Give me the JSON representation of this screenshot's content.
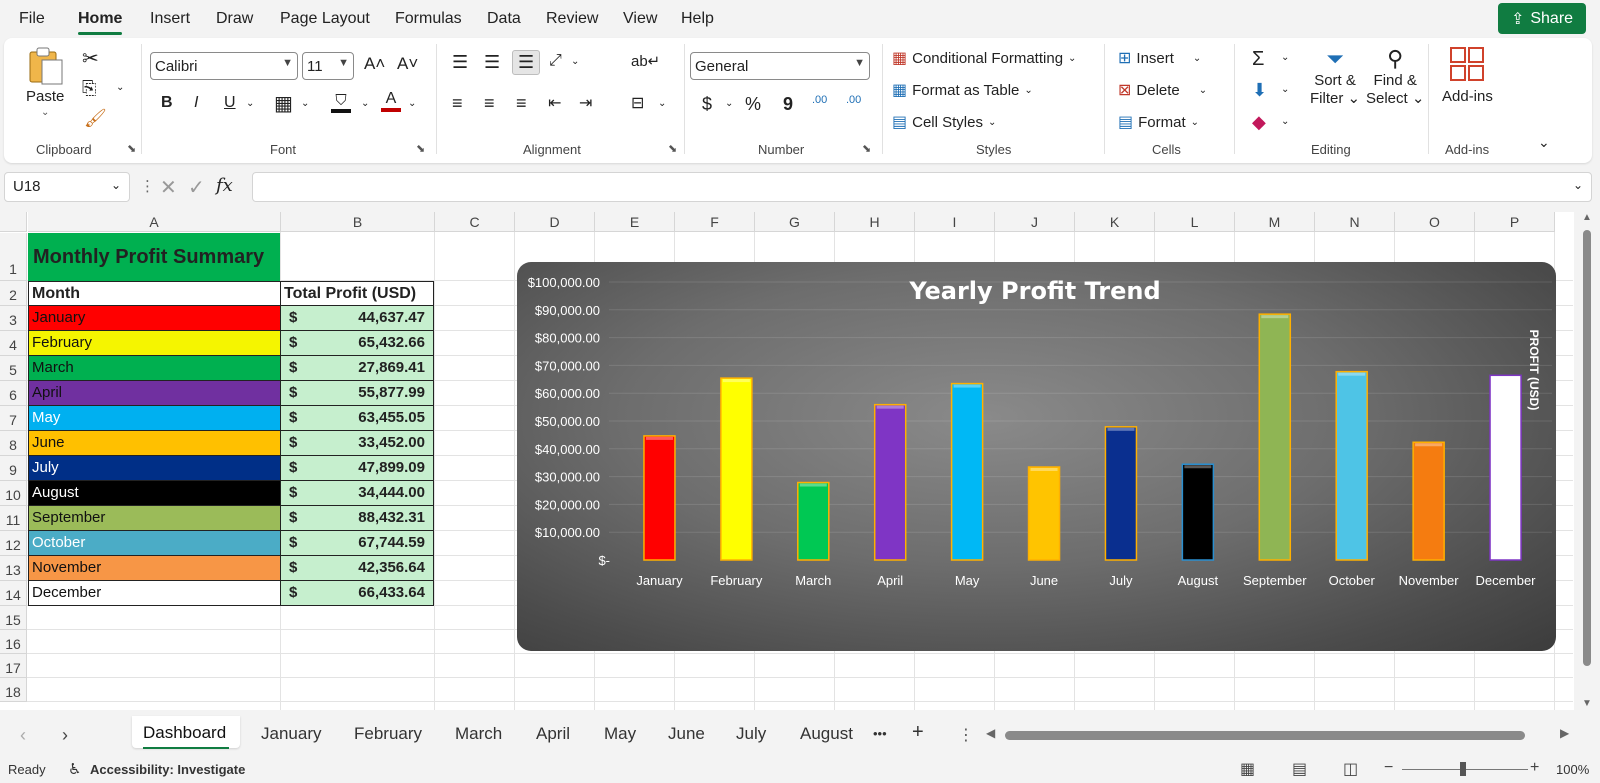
{
  "menu": {
    "tabs": [
      "File",
      "Home",
      "Insert",
      "Draw",
      "Page Layout",
      "Formulas",
      "Data",
      "Review",
      "View",
      "Help"
    ],
    "active": "Home",
    "share_label": "Share"
  },
  "ribbon": {
    "clipboard": {
      "paste": "Paste",
      "label": "Clipboard"
    },
    "font": {
      "name": "Calibri",
      "size": "11",
      "bold": "B",
      "italic": "I",
      "underline": "U",
      "label": "Font"
    },
    "alignment": {
      "label": "Alignment"
    },
    "number": {
      "format": "General",
      "currency": "$",
      "percent": "%",
      "comma": "9",
      "inc_decimal": ".00",
      "dec_decimal": ".00",
      "label": "Number"
    },
    "styles": {
      "conditional": "Conditional Formatting",
      "format_table": "Format as Table",
      "cell_styles": "Cell Styles",
      "label": "Styles"
    },
    "cells": {
      "insert": "Insert",
      "delete": "Delete",
      "format": "Format",
      "label": "Cells"
    },
    "editing": {
      "sort_filter_1": "Sort &",
      "sort_filter_2": "Filter",
      "find_select_1": "Find &",
      "find_select_2": "Select",
      "label": "Editing"
    },
    "addins": {
      "button": "Add-ins",
      "label": "Add-ins"
    }
  },
  "formula_bar": {
    "name_box": "U18",
    "fx": "fx",
    "formula": ""
  },
  "grid": {
    "columns": [
      "A",
      "B",
      "C",
      "D",
      "E",
      "F",
      "G",
      "H",
      "I",
      "J",
      "K",
      "L",
      "M",
      "N",
      "O",
      "P"
    ],
    "rows": [
      "1",
      "2",
      "3",
      "4",
      "5",
      "6",
      "7",
      "8",
      "9",
      "10",
      "11",
      "12",
      "13",
      "14",
      "15",
      "16",
      "17",
      "18"
    ],
    "title": "Monthly Profit Summary",
    "header_month": "Month",
    "header_profit": "Total Profit (USD)",
    "currency_symbol": "$",
    "months": [
      "January",
      "February",
      "March",
      "April",
      "May",
      "June",
      "July",
      "August",
      "September",
      "October",
      "November",
      "December"
    ],
    "profits": [
      "44,637.47",
      "65,432.66",
      "27,869.41",
      "55,877.99",
      "63,455.05",
      "33,452.00",
      "47,899.09",
      "34,444.00",
      "88,432.31",
      "67,744.59",
      "42,356.64",
      "66,433.64"
    ],
    "month_colors": [
      "#ff0000",
      "#f5f500",
      "#00b050",
      "#7030a0",
      "#00b0f0",
      "#ffc000",
      "#002f87",
      "#000000",
      "#9bbb59",
      "#4bacc6",
      "#f79646",
      "#ffffff"
    ],
    "title_bg": "#00b050",
    "profit_bg": "#c6efce"
  },
  "chart_data": {
    "type": "bar",
    "title": "Yearly Profit Trend",
    "ylabel": "PROFIT (USD)",
    "xlabel": "",
    "categories": [
      "January",
      "February",
      "March",
      "April",
      "May",
      "June",
      "July",
      "August",
      "September",
      "October",
      "November",
      "December"
    ],
    "values": [
      44637.47,
      65432.66,
      27869.41,
      55877.99,
      63455.05,
      33452.0,
      47899.09,
      34444.0,
      88432.31,
      67744.59,
      42356.64,
      66433.64
    ],
    "colors": [
      "#ff0000",
      "#ffff00",
      "#00c853",
      "#7f35c5",
      "#00b8f5",
      "#ffc400",
      "#0a2f8f",
      "#000000",
      "#8fb554",
      "#4ec4e6",
      "#f57c10",
      "#ffffff"
    ],
    "ylim": [
      0,
      100000
    ],
    "yticks": [
      "$-",
      "$10,000.00",
      "$20,000.00",
      "$30,000.00",
      "$40,000.00",
      "$50,000.00",
      "$60,000.00",
      "$70,000.00",
      "$80,000.00",
      "$90,000.00",
      "$100,000.00"
    ],
    "grid": true
  },
  "sheets": {
    "tabs": [
      "Dashboard",
      "January",
      "February",
      "March",
      "April",
      "May",
      "June",
      "July",
      "August"
    ],
    "active": "Dashboard",
    "more": "•••",
    "add": "+"
  },
  "status": {
    "ready": "Ready",
    "accessibility": "Accessibility: Investigate",
    "zoom": "100%"
  }
}
